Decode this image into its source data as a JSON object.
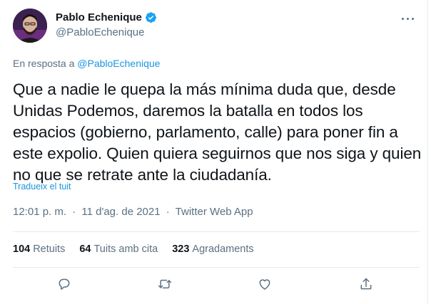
{
  "author": {
    "display_name": "Pablo Echenique",
    "handle": "@PabloEchenique",
    "verified": true
  },
  "reply": {
    "prefix": "En resposta a",
    "handle": "@PabloEchenique"
  },
  "tweet_text": "Que a nadie le quepa la más mínima duda que, desde Unidas Podemos, daremos la batalla en todos los espacios (gobierno, parlamento, calle) para poner fin a este expolio. Quien quiera seguirnos que nos siga y quien no que se retrate ante la ciudadanía.",
  "translate_label": "Tradueix el tuit",
  "meta": {
    "time": "12:01 p. m.",
    "date": "11 d'ag. de 2021",
    "source": "Twitter Web App",
    "separator": "·"
  },
  "stats": {
    "retweets": {
      "count": "104",
      "label": "Retuits"
    },
    "quotes": {
      "count": "64",
      "label": "Tuits amb cita"
    },
    "likes": {
      "count": "323",
      "label": "Agradaments"
    }
  },
  "colors": {
    "link": "#1b95e0",
    "secondary": "#5b7083",
    "divider": "#e6ecf0",
    "verified": "#1da1f2"
  },
  "icons": {
    "more": "more-horizontal-icon",
    "reply": "reply-icon",
    "retweet": "retweet-icon",
    "like": "heart-icon",
    "share": "share-icon"
  }
}
